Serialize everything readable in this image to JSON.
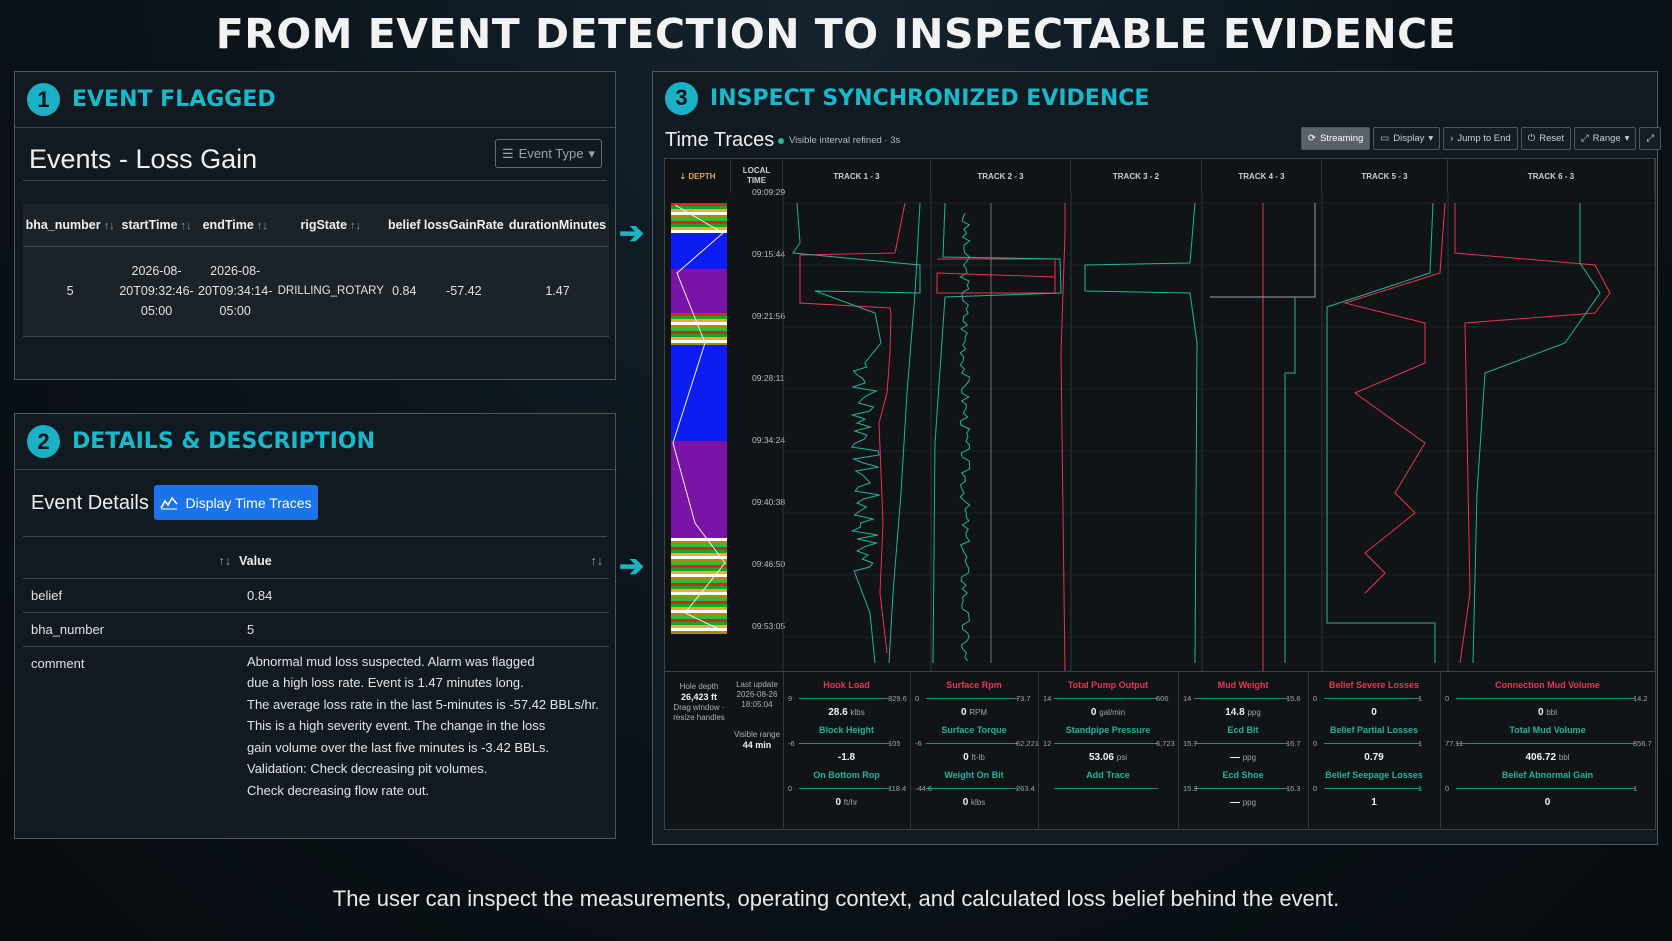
{
  "headline": "FROM EVENT DETECTION TO INSPECTABLE EVIDENCE",
  "caption": "The user can inspect the measurements, operating context, and calculated loss belief behind the event.",
  "colors": {
    "accent": "#19b6c8",
    "button_blue": "#1a73e8",
    "loss_red": "#e8334f",
    "trace_teal": "#1fb39a"
  },
  "panel1": {
    "step": "1",
    "title": "EVENT FLAGGED",
    "heading": "Events - Loss Gain",
    "filter_button": "Event Type",
    "columns": [
      "bha_number",
      "startTime",
      "endTime",
      "rigState",
      "belief",
      "lossGainRate",
      "durationMinutes"
    ],
    "sortable": [
      true,
      true,
      true,
      true,
      false,
      false,
      false
    ],
    "row": {
      "bha_number": "5",
      "startTime": [
        "2026-08-",
        "20T09:32:46-",
        "05:00"
      ],
      "endTime": [
        "2026-08-",
        "20T09:34:14-",
        "05:00"
      ],
      "rigState": "DRILLING_ROTARY",
      "belief": "0.84",
      "lossGainRate": "-57.42",
      "durationMinutes": "1.47"
    }
  },
  "panel2": {
    "step": "2",
    "title": "DETAILS & DESCRIPTION",
    "heading": "Event Details",
    "button": "Display Time Traces",
    "value_header": "Value",
    "rows": [
      {
        "key": "belief",
        "value": "0.84"
      },
      {
        "key": "bha_number",
        "value": "5"
      }
    ],
    "comment_key": "comment",
    "comment_lines": [
      "Abnormal mud loss suspected. Alarm was flagged",
      "due a high loss rate. Event is 1.47 minutes long.",
      "The average loss rate in the last 5-minutes is -57.42 BBLs/hr.",
      "This is a high severity event. The change in the loss",
      "gain volume over the last five minutes is -3.42 BBLs.",
      "Validation: Check decreasing pit volumes.",
      "Check decreasing flow rate out."
    ]
  },
  "panel3": {
    "step": "3",
    "title": "INSPECT SYNCHRONIZED EVIDENCE",
    "heading": "Time Traces",
    "status": "Visible interval refined · 3s",
    "toolbar": [
      "Streaming",
      "Display",
      "Jump to End",
      "Reset",
      "Range"
    ],
    "depth_label": "DEPTH",
    "time_header": [
      "LOCAL",
      "TIME"
    ],
    "tracks": [
      "TRACK 1 - 3",
      "TRACK 2 - 3",
      "TRACK 3 - 2",
      "TRACK 4 - 3",
      "TRACK 5 - 3",
      "TRACK 6 - 3"
    ],
    "times": [
      "09:09:29",
      "09:15:44",
      "09:21:56",
      "09:28:11",
      "09:34:24",
      "09:40:38",
      "09:46:50",
      "09:53:05"
    ],
    "hole_depth_label": "Hole depth",
    "hole_depth": "26,423 ft",
    "drag_hint": [
      "Drag window ·",
      "resize handles"
    ],
    "last_update_label": "Last update",
    "last_update": [
      "2026-08-26",
      "18:05:04"
    ],
    "visible_range_label": "Visible range",
    "visible_range": "44 min",
    "columns": [
      {
        "items": [
          {
            "name": "Hook Load",
            "min": "9",
            "max": "329.6",
            "value": "28.6",
            "unit": "klbs",
            "color": "#e8334f"
          },
          {
            "name": "Block Height",
            "min": "-6",
            "max": "105",
            "value": "-1.8",
            "unit": "",
            "color": "#1fb39a"
          },
          {
            "name": "On Bottom Rop",
            "min": "0",
            "max": "118.4",
            "value": "0",
            "unit": "ft/hr",
            "color": "#1fb39a"
          }
        ]
      },
      {
        "items": [
          {
            "name": "Surface Rpm",
            "min": "0",
            "max": "73.7",
            "value": "0",
            "unit": "RPM",
            "color": "#e8334f"
          },
          {
            "name": "Surface Torque",
            "min": "-6",
            "max": "62,221",
            "value": "0",
            "unit": "ft-lb",
            "color": "#1fb39a"
          },
          {
            "name": "Weight On Bit",
            "min": "-44.6",
            "max": "263.4",
            "value": "0",
            "unit": "klbs",
            "color": "#1fb39a"
          }
        ]
      },
      {
        "items": [
          {
            "name": "Total Pump Output",
            "min": "14",
            "max": "606",
            "value": "0",
            "unit": "gal/min",
            "color": "#e8334f"
          },
          {
            "name": "Standpipe Pressure",
            "min": "12",
            "max": "6,723",
            "value": "53.06",
            "unit": "psi",
            "color": "#1fb39a"
          },
          {
            "name": "Add Trace",
            "min": "",
            "max": "",
            "value": "",
            "unit": "",
            "color": "#1fb39a"
          }
        ]
      },
      {
        "items": [
          {
            "name": "Mud Weight",
            "min": "14",
            "max": "15.6",
            "value": "14.8",
            "unit": "ppg",
            "color": "#e8334f"
          },
          {
            "name": "Ecd Bit",
            "min": "15.7",
            "max": "16.7",
            "value": "—",
            "unit": "ppg",
            "color": "#1fb39a"
          },
          {
            "name": "Ecd Shoe",
            "min": "15.3",
            "max": "16.3",
            "value": "—",
            "unit": "ppg",
            "color": "#1fb39a"
          }
        ]
      },
      {
        "items": [
          {
            "name": "Belief Severe Losses",
            "min": "0",
            "max": "1",
            "value": "0",
            "unit": "",
            "color": "#e8334f"
          },
          {
            "name": "Belief Partial Losses",
            "min": "0",
            "max": "1",
            "value": "0.79",
            "unit": "",
            "color": "#1fb39a"
          },
          {
            "name": "Belief Seepage Losses",
            "min": "0",
            "max": "1",
            "value": "1",
            "unit": "",
            "color": "#1fb39a"
          }
        ]
      },
      {
        "items": [
          {
            "name": "Connection Mud Volume",
            "min": "0",
            "max": "14.2",
            "value": "0",
            "unit": "bbl",
            "color": "#e8334f"
          },
          {
            "name": "Total Mud Volume",
            "min": "77.11",
            "max": "856.7",
            "value": "406.72",
            "unit": "bbl",
            "color": "#1fb39a"
          },
          {
            "name": "Belief Abnormal Gain",
            "min": "0",
            "max": "1",
            "value": "0",
            "unit": "",
            "color": "#1fb39a"
          }
        ]
      }
    ]
  }
}
